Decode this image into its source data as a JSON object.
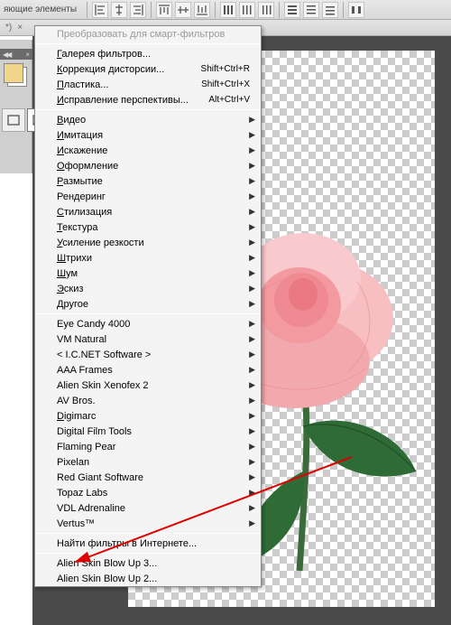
{
  "toolbar": {
    "label_fragment": "яющие элементы"
  },
  "subtoolbar": {
    "marker": "*)"
  },
  "panel": {
    "arrows": "◀◀"
  },
  "menu": {
    "groups": [
      [
        {
          "label": "Преобразовать для смарт-фильтров",
          "disabled": true
        }
      ],
      [
        {
          "label": "Галерея фильтров...",
          "underlined": true
        },
        {
          "label": "Коррекция дисторсии...",
          "shortcut": "Shift+Ctrl+R",
          "underlined": true
        },
        {
          "label": "Пластика...",
          "shortcut": "Shift+Ctrl+X",
          "underlined": true
        },
        {
          "label": "Исправление перспективы...",
          "shortcut": "Alt+Ctrl+V",
          "underlined": true
        }
      ],
      [
        {
          "label": "Видео",
          "submenu": true,
          "underlined": true
        },
        {
          "label": "Имитация",
          "submenu": true,
          "underlined": true
        },
        {
          "label": "Искажение",
          "submenu": true,
          "underlined": true
        },
        {
          "label": "Оформление",
          "submenu": true,
          "underlined": true
        },
        {
          "label": "Размытие",
          "submenu": true,
          "underlined": true
        },
        {
          "label": "Рендеринг",
          "submenu": true
        },
        {
          "label": "Стилизация",
          "submenu": true,
          "underlined": true
        },
        {
          "label": "Текстура",
          "submenu": true,
          "underlined": true
        },
        {
          "label": "Усиление резкости",
          "submenu": true,
          "underlined": true
        },
        {
          "label": "Штрихи",
          "submenu": true,
          "underlined": true
        },
        {
          "label": "Шум",
          "submenu": true,
          "underlined": true
        },
        {
          "label": "Эскиз",
          "submenu": true,
          "underlined": true
        },
        {
          "label": "Другое",
          "submenu": true,
          "underlined": true
        }
      ],
      [
        {
          "label": " Eye Candy 4000",
          "submenu": true
        },
        {
          "label": " VM Natural",
          "submenu": true
        },
        {
          "label": "< I.C.NET Software >",
          "submenu": true
        },
        {
          "label": "AAA Frames",
          "submenu": true
        },
        {
          "label": "Alien Skin Xenofex 2",
          "submenu": true
        },
        {
          "label": "AV Bros.",
          "submenu": true
        },
        {
          "label": "Digimarc",
          "submenu": true,
          "underlined": true
        },
        {
          "label": "Digital Film Tools",
          "submenu": true
        },
        {
          "label": "Flaming Pear",
          "submenu": true
        },
        {
          "label": "Pixelan",
          "submenu": true
        },
        {
          "label": "Red Giant Software",
          "submenu": true
        },
        {
          "label": "Topaz Labs",
          "submenu": true
        },
        {
          "label": "VDL Adrenaline",
          "submenu": true
        },
        {
          "label": "Vertus™",
          "submenu": true
        }
      ],
      [
        {
          "label": "Найти фильтры в Интернете..."
        }
      ],
      [
        {
          "label": "Alien Skin Blow Up 3..."
        },
        {
          "label": "Alien Skin Blow Up 2..."
        }
      ]
    ]
  }
}
